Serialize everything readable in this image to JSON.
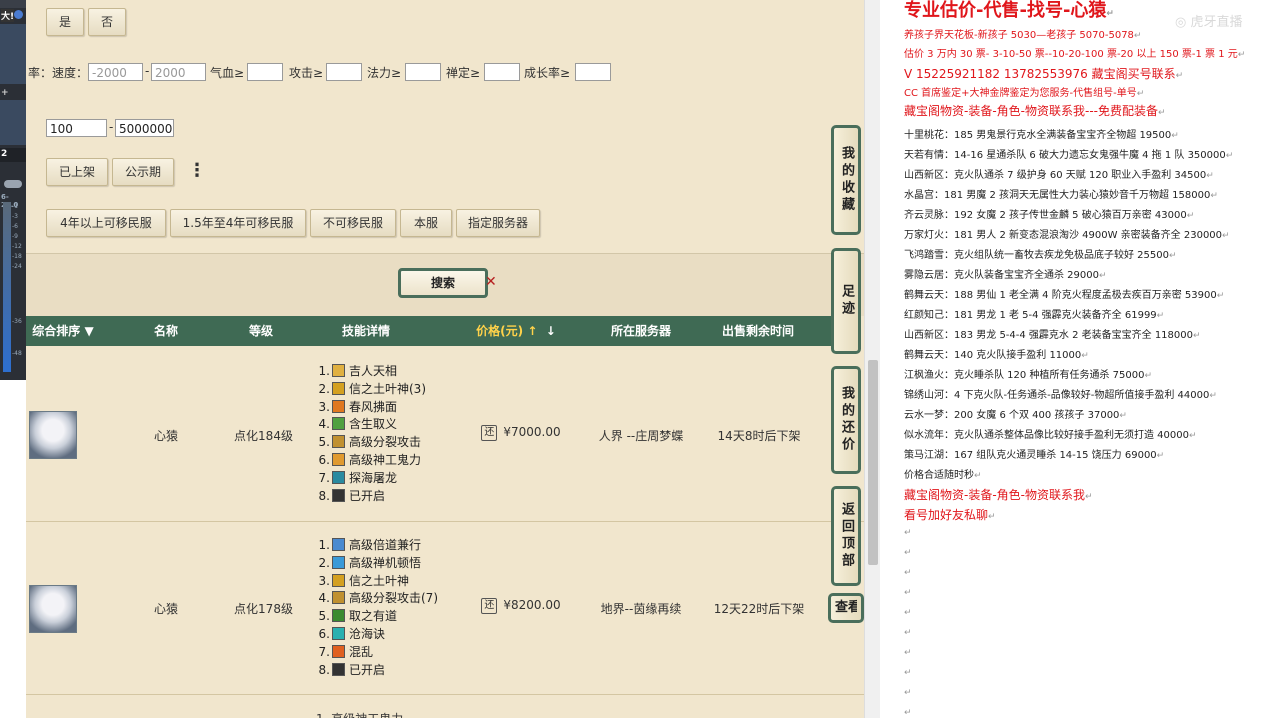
{
  "filters": {
    "yes_label": "是",
    "no_label": "否",
    "rate_fragment": "率：",
    "speed_label": "速度：",
    "speed_min_placeholder": "-2000",
    "speed_max_placeholder": "2000",
    "range_dash": "-",
    "hp_label": "气血≥",
    "attack_label": "攻击≥",
    "magic_label": "法力≥",
    "zen_label": "禅定≥",
    "growth_label": "成长率≥",
    "price_min": "100",
    "price_max": "5000000",
    "listed_label": "已上架",
    "public_label": "公示期",
    "more_icon": "⋮",
    "migrate_4plus": "4年以上可移民服",
    "migrate_15_4": "1.5年至4年可移民服",
    "no_migrate": "不可移民服",
    "this_server": "本服",
    "specified_server": "指定服务器"
  },
  "search": {
    "label": "搜索",
    "clear_icon": "✕"
  },
  "table": {
    "headers": {
      "sort": "综合排序",
      "name": "名称",
      "level": "等级",
      "skills": "技能详情",
      "price": "价格(元)",
      "server": "所在服务器",
      "time_left": "出售剩余时间"
    },
    "rows": [
      {
        "name": "心猿",
        "level": "点化184级",
        "price": "¥7000.00",
        "server": "人界 --庄周梦蝶",
        "time": "14天8时后下架",
        "skills": [
          {
            "n": "1.",
            "text": "吉人天相",
            "color": "#e0b040"
          },
          {
            "n": "2.",
            "text": "信之土叶神(3)",
            "color": "#d4a020"
          },
          {
            "n": "3.",
            "text": "春风拂面",
            "color": "#e07820"
          },
          {
            "n": "4.",
            "text": "含生取义",
            "color": "#50a040"
          },
          {
            "n": "5.",
            "text": "高级分裂攻击",
            "color": "#c09030"
          },
          {
            "n": "6.",
            "text": "高级神工鬼力",
            "color": "#e09a30"
          },
          {
            "n": "7.",
            "text": "探海屠龙",
            "color": "#2a8aa0"
          },
          {
            "n": "8.",
            "text": "已开启",
            "color": "#333333"
          }
        ]
      },
      {
        "name": "心猿",
        "level": "点化178级",
        "price": "¥8200.00",
        "server": "地界--茵缘再续",
        "time": "12天22时后下架",
        "skills": [
          {
            "n": "1.",
            "text": "高级倍道兼行",
            "color": "#4a8ad0"
          },
          {
            "n": "2.",
            "text": "高级禅机顿悟",
            "color": "#3a9ad8"
          },
          {
            "n": "3.",
            "text": "信之土叶神",
            "color": "#d4a020"
          },
          {
            "n": "4.",
            "text": "高级分裂攻击(7)",
            "color": "#c09030"
          },
          {
            "n": "5.",
            "text": "取之有道",
            "color": "#3a8a30"
          },
          {
            "n": "6.",
            "text": "沧海诀",
            "color": "#2ab0b0"
          },
          {
            "n": "7.",
            "text": "混乱",
            "color": "#e06020"
          },
          {
            "n": "8.",
            "text": "已开启",
            "color": "#333333"
          }
        ]
      }
    ],
    "partial_row_skill": "1. 高级神工鬼力"
  },
  "side_buttons": {
    "favorites": "我的收藏",
    "footprint": "足迹",
    "bargain": "我的还价",
    "back_top": "返回顶部",
    "check": "查看"
  },
  "doc": {
    "watermark": "◎ 虎牙直播",
    "lines": [
      {
        "text": "专业估价-代售-找号-心猿",
        "style": "red big"
      },
      {
        "text": "养孩子界天花板-新孩子 5030—老孩子 5070-5078",
        "style": "red"
      },
      {
        "text": "估价 3 万内 30 票- 3-10-50 票--10-20-100 票-20 以上 150 票-1 票 1 元",
        "style": "red"
      },
      {
        "text": "V 15225921182        13782553976     藏宝阁买号联系",
        "style": "red mid"
      },
      {
        "text": "CC 首席鉴定+大神金牌鉴定为您服务-代售组号-单号",
        "style": "red"
      },
      {
        "text": "藏宝阁物资-装备-角色-物资联系我---免费配装备",
        "style": "red mid"
      },
      {
        "text": "十里桃花：185 男鬼景行克水全满装备宝宝齐全物超 19500",
        "style": ""
      },
      {
        "text": "天若有情：14-16 星通杀队 6 破大力遗忘女鬼强牛魔 4 拖 1 队 350000",
        "style": ""
      },
      {
        "text": "山西新区：克火队通杀 7 级护身 60 天赋 120 职业入手盈利 34500",
        "style": ""
      },
      {
        "text": "水晶宫：181 男魔 2 孩洞天无属性大力装心猿妙音千万物超 158000",
        "style": ""
      },
      {
        "text": "齐云灵脉：192 女魔 2 孩子传世金麟 5 破心猿百万亲密 43000",
        "style": ""
      },
      {
        "text": "万家灯火：181 男人 2 新变态混浪淘沙 4900W 亲密装备齐全 230000",
        "style": ""
      },
      {
        "text": "飞鸿踏雪：克火组队统一畜牧去疾龙免极品底子较好 25500",
        "style": ""
      },
      {
        "text": "雾隐云居：克火队装备宝宝齐全通杀 29000",
        "style": ""
      },
      {
        "text": "鹤舞云天：188 男仙 1 老全满 4 阶克火程度孟极去疾百万亲密 53900",
        "style": ""
      },
      {
        "text": "红颜知己：181 男龙 1 老 5-4 强霹克火装备齐全 61999",
        "style": ""
      },
      {
        "text": "山西新区：183 男龙 5-4-4 强霹克水 2 老装备宝宝齐全 118000",
        "style": ""
      },
      {
        "text": "鹤舞云天：140 克火队接手盈利 11000",
        "style": ""
      },
      {
        "text": "江枫渔火：克火睡杀队 120 种植所有任务通杀 75000",
        "style": ""
      },
      {
        "text": "锦绣山河：4 下克火队-任务通杀-品像较好-物超所值接手盈利 44000",
        "style": ""
      },
      {
        "text": "云水一梦：200 女魔 6 个双 400 孩孩子 37000",
        "style": ""
      },
      {
        "text": "似水流年：克火队通杀整体品像比较好接手盈利无须打造 40000",
        "style": ""
      },
      {
        "text": "策马江湖：167 组队克火通灵睡杀 14-15 饶压力 69000",
        "style": ""
      },
      {
        "text": "价格合适随时秒",
        "style": ""
      },
      {
        "text": "藏宝阁物资-装备-角色-物资联系我",
        "style": "red mid"
      },
      {
        "text": "看号加好友私聊",
        "style": "red mid"
      }
    ],
    "para_mark": "↵"
  },
  "left_strip": {
    "label_top": "大!",
    "plus": "+",
    "num": "2",
    "value": "6-24.0",
    "ticks": [
      "-1",
      "-3",
      "-6",
      "-9",
      "-12",
      "-18",
      "-24"
    ],
    "low_ticks": [
      "-36",
      "-48"
    ]
  }
}
